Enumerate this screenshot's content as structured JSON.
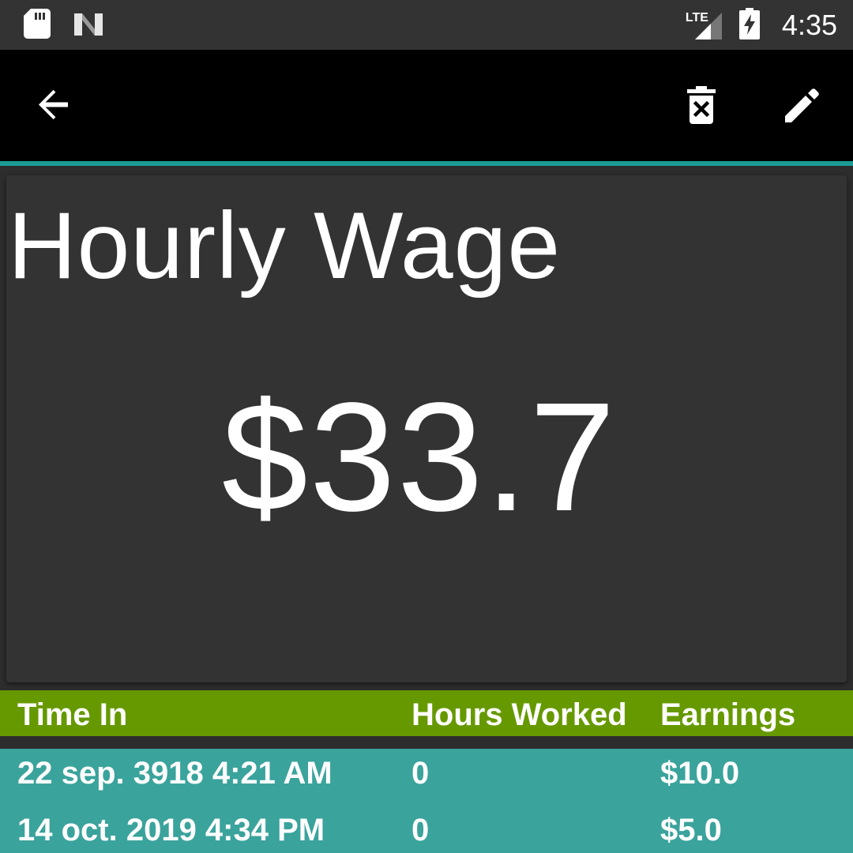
{
  "status_bar": {
    "time": "4:35",
    "network": "LTE",
    "icons": [
      "sd-card-icon",
      "n-logo-icon",
      "lte-signal-icon",
      "battery-charging-icon"
    ]
  },
  "toolbar": {
    "icons": [
      "arrow-back-icon",
      "delete-icon",
      "edit-pencil-icon"
    ]
  },
  "card": {
    "title": "Hourly Wage",
    "amount": "$33.7"
  },
  "table": {
    "headers": [
      "Time In",
      "Hours Worked",
      "Earnings"
    ],
    "rows": [
      [
        "22 sep. 3918 4:21 AM",
        "0",
        "$10.0"
      ],
      [
        "14 oct. 2019 4:34 PM",
        "0",
        "$5.0"
      ]
    ]
  },
  "colors": {
    "accent": "#1b9c93",
    "header": "#669900",
    "rows": "#3aa39c",
    "background": "#2d2d2d"
  }
}
